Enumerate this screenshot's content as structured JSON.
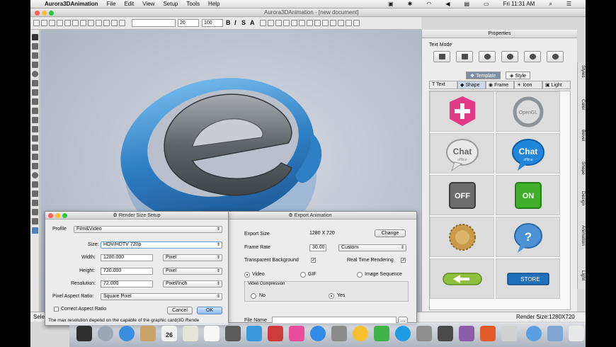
{
  "menubar": {
    "app_name": "Aurora3DAnimation",
    "items": [
      "File",
      "Edit",
      "View",
      "Setup",
      "Tools",
      "Help"
    ],
    "clock": "Fri 11:31 AM"
  },
  "window": {
    "title": "Aurora3DAnimation - [new document]"
  },
  "toolbar": {
    "font_size": "20",
    "zoom": "100",
    "bold": "B",
    "italic": "I",
    "shadow": "S",
    "stroke": "A"
  },
  "properties": {
    "title": "Properties",
    "text_mode_label": "Text Mode",
    "segments": [
      "Template",
      "Style"
    ],
    "tabs": [
      "Text",
      "Shape",
      "Frame",
      "Icon",
      "Light"
    ],
    "thumbs": [
      {
        "label": ""
      },
      {
        "label": "OpenGL"
      },
      {
        "label": "Chat",
        "sub": "offline"
      },
      {
        "label": "Chat",
        "sub": "offline"
      },
      {
        "label": "OFF"
      },
      {
        "label": "ON"
      },
      {
        "label": ""
      },
      {
        "label": "?"
      },
      {
        "label": ""
      },
      {
        "label": "STORE"
      }
    ]
  },
  "side_tabs": [
    "Styles",
    "Color",
    "Bevel",
    "Shape",
    "Design",
    "Animation",
    "Light"
  ],
  "status": {
    "left": "Sele",
    "render_size": "Render Size:1280X720"
  },
  "render_dialog": {
    "title": "Render Size Setup",
    "profile_label": "Profile",
    "profile_value": "Film&Video",
    "size_label": "Size:",
    "size_value": "HDV/HDTV 720p",
    "width_label": "Width:",
    "width_value": "1280.000",
    "height_label": "Height:",
    "height_value": "720.000",
    "resolution_label": "Resolution:",
    "resolution_value": "72.000",
    "unit_pixel": "Pixel",
    "unit_res": "Pixel/Inch",
    "aspect_label": "Pixel Aspect Ratio:",
    "aspect_value": "Square Pixel",
    "correct_aspect": "Correct Aspect Ratio",
    "cancel": "Cancel",
    "ok": "OK",
    "note": "The max resolution depend on the capable of the graphic card(3D Rende"
  },
  "export_dialog": {
    "title": "Export Animation",
    "export_size_label": "Export Size",
    "export_size_value": "1280 X 720",
    "change": "Change",
    "frame_rate_label": "Frame Rate",
    "frame_rate_value": "30.00",
    "frame_rate_mode": "Custom",
    "transparent_bg": "Transparent Background",
    "real_time": "Real Time Rendering",
    "video": "Video",
    "gif": "GIF",
    "image_sequence": "Image Sequence",
    "video_compression": "Video Compression",
    "no": "No",
    "yes": "Yes",
    "file_name": "File Name"
  },
  "dock": {
    "calendar_day": "26"
  }
}
